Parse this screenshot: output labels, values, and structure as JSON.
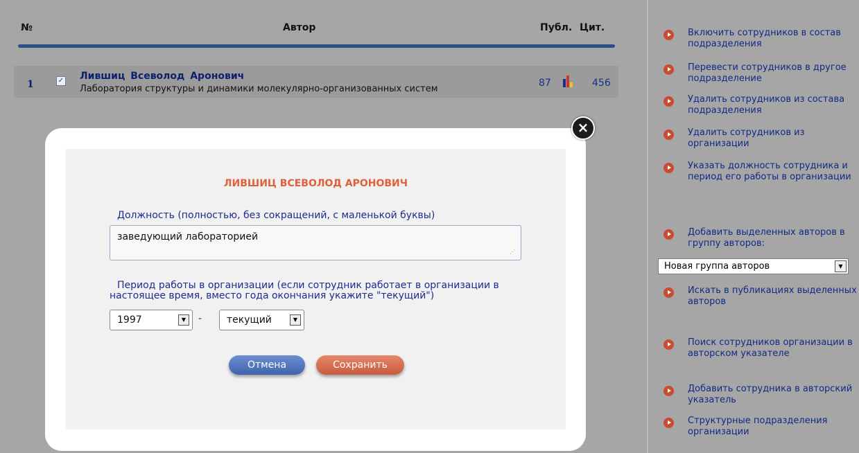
{
  "table": {
    "headers": {
      "no": "№",
      "author": "Автор",
      "publ": "Публ.",
      "cit": "Цит."
    },
    "rows": [
      {
        "num": "1",
        "checked": "✓",
        "name": "Лившиц Всеволод Аронович",
        "organization": "Лаборатория структуры и динамики молекулярно-организованных систем",
        "publ": "87",
        "cit": "456"
      }
    ]
  },
  "sidebar": {
    "items": [
      {
        "label": "Включить сотрудников в состав подразделения"
      },
      {
        "label": "Перевести сотрудников в другое подразделение"
      },
      {
        "label": "Удалить сотрудников из состава подразделения"
      },
      {
        "label": "Удалить сотрудников из организации"
      },
      {
        "label": "Указать должность сотрудника и период его работы в организации"
      },
      {
        "label": "Добавить выделенных авторов в группу авторов:"
      },
      {
        "label": "Искать в публикациях выделенных авторов"
      },
      {
        "label": "Поиск сотрудников организации в авторском указателе"
      },
      {
        "label": "Добавить сотрудника в авторский указатель"
      },
      {
        "label": "Структурные подразделения организации"
      }
    ],
    "group_select": {
      "value": "Новая группа авторов"
    }
  },
  "modal": {
    "close": "×",
    "title": "ЛИВШИЦ ВСЕВОЛОД АРОНОВИЧ",
    "position_label": "Должность (полностью, без сокращений, с маленькой буквы)",
    "position_value": "заведующий лабораторией",
    "period_label_line1": "Период работы в организации (если сотрудник работает в организации в",
    "period_label_line2": "настоящее время, вместо года окончания укажите \"текущий\")",
    "start_year": "1997",
    "dash": "-",
    "end_year": "текущий",
    "cancel": "Отмена",
    "save": "Сохранить"
  },
  "colors": {
    "accent_blue": "#2e4f86",
    "link": "#102a86",
    "title_orange": "#e0603a",
    "bullet": "#c84b32"
  }
}
